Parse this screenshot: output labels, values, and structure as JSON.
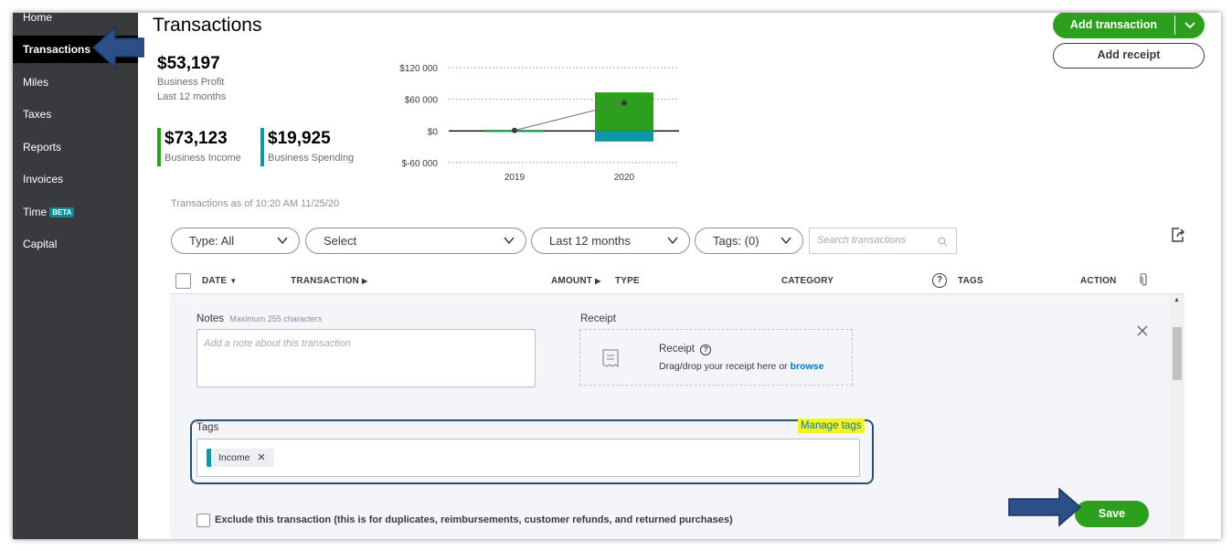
{
  "sidebar": {
    "items": [
      {
        "label": "Home"
      },
      {
        "label": "Transactions"
      },
      {
        "label": "Miles"
      },
      {
        "label": "Taxes"
      },
      {
        "label": "Reports"
      },
      {
        "label": "Invoices"
      },
      {
        "label": "Time"
      },
      {
        "label": "Capital"
      }
    ],
    "beta_badge": "BETA"
  },
  "header": {
    "title": "Transactions",
    "add_transaction": "Add transaction",
    "add_receipt": "Add receipt"
  },
  "summary": {
    "profit_value": "$53,197",
    "profit_label": "Business Profit",
    "profit_period": "Last 12 months",
    "income_value": "$73,123",
    "income_label": "Business Income",
    "spending_value": "$19,925",
    "spending_label": "Business Spending",
    "income_color": "#2ca01c",
    "spending_color": "#0d97a8"
  },
  "chart_data": {
    "type": "bar",
    "categories": [
      "2019",
      "2020"
    ],
    "series": [
      {
        "values": [
          2000,
          73123
        ]
      },
      {
        "values": [
          -2000,
          -19925
        ]
      }
    ],
    "profit_line": {
      "values": [
        1000,
        53197
      ]
    },
    "y_ticks": [
      "$120 000",
      "$60 000",
      "$0",
      "$-60 000"
    ],
    "ylim": [
      -60000,
      120000
    ],
    "grid": true
  },
  "asof": "Transactions as of 10:20 AM 11/25/20",
  "filters": {
    "type": "Type: All",
    "select": "Select",
    "period": "Last 12 months",
    "tags": "Tags: (0)",
    "search_placeholder": "Search transactions"
  },
  "table": {
    "headers": {
      "date": "DATE",
      "transaction": "TRANSACTION",
      "amount": "AMOUNT",
      "type": "TYPE",
      "category": "CATEGORY",
      "tags": "TAGS",
      "action": "ACTION"
    }
  },
  "panel": {
    "notes_label": "Notes",
    "notes_hint": "Maximum 255 characters",
    "notes_placeholder": "Add a note about this transaction",
    "receipt_label": "Receipt",
    "receipt_title": "Receipt",
    "receipt_help": "Drag/drop your receipt here or",
    "receipt_browse": "browse",
    "tags_label": "Tags",
    "manage_tags": "Manage tags",
    "tag_chip": "Income",
    "exclude_text": "Exclude this transaction (this is for duplicates, reimbursements, customer refunds, and returned purchases)",
    "save": "Save"
  }
}
